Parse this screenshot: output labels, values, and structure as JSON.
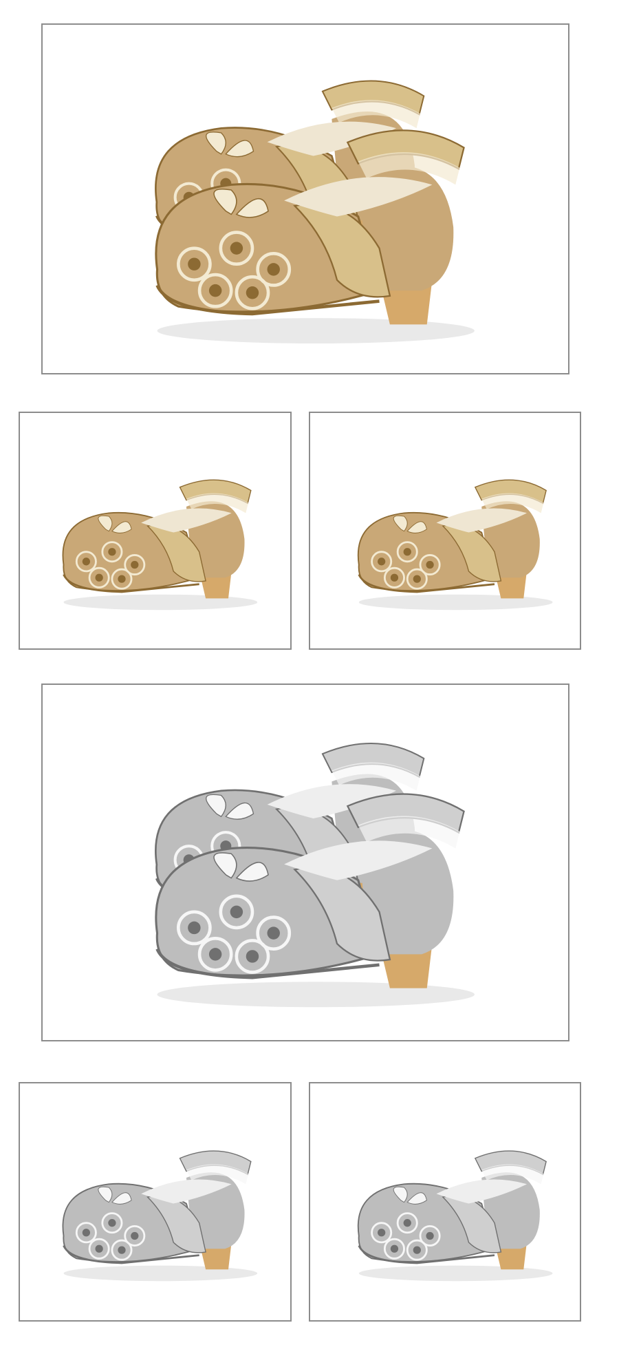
{
  "photos": [
    {
      "variant": "gold",
      "view": "pair",
      "colors": {
        "metal": "#d8c08a",
        "metalHi": "#f3ead2",
        "metalLo": "#8c6a33",
        "sparkle": "#c9a877",
        "heel": "#d6a96a",
        "lining": "#efe6d2"
      }
    },
    {
      "variant": "gold",
      "view": "single-left",
      "colors": {
        "metal": "#d8c08a",
        "metalHi": "#f3ead2",
        "metalLo": "#8c6a33",
        "sparkle": "#c9a877",
        "heel": "#d6a96a",
        "lining": "#efe6d2"
      }
    },
    {
      "variant": "gold",
      "view": "single-right",
      "colors": {
        "metal": "#d8c08a",
        "metalHi": "#f3ead2",
        "metalLo": "#8c6a33",
        "sparkle": "#c9a877",
        "heel": "#d6a96a",
        "lining": "#efe6d2"
      }
    },
    {
      "variant": "silver",
      "view": "pair",
      "colors": {
        "metal": "#cfcfcf",
        "metalHi": "#f6f6f6",
        "metalLo": "#707070",
        "sparkle": "#bdbdbd",
        "heel": "#d6a96a",
        "lining": "#eeeeee"
      }
    },
    {
      "variant": "silver",
      "view": "single-left",
      "colors": {
        "metal": "#cfcfcf",
        "metalHi": "#f6f6f6",
        "metalLo": "#707070",
        "sparkle": "#bdbdbd",
        "heel": "#d6a96a",
        "lining": "#eeeeee"
      }
    },
    {
      "variant": "silver",
      "view": "single-right",
      "colors": {
        "metal": "#cfcfcf",
        "metalHi": "#f6f6f6",
        "metalLo": "#707070",
        "sparkle": "#bdbdbd",
        "heel": "#d6a96a",
        "lining": "#eeeeee"
      }
    }
  ]
}
